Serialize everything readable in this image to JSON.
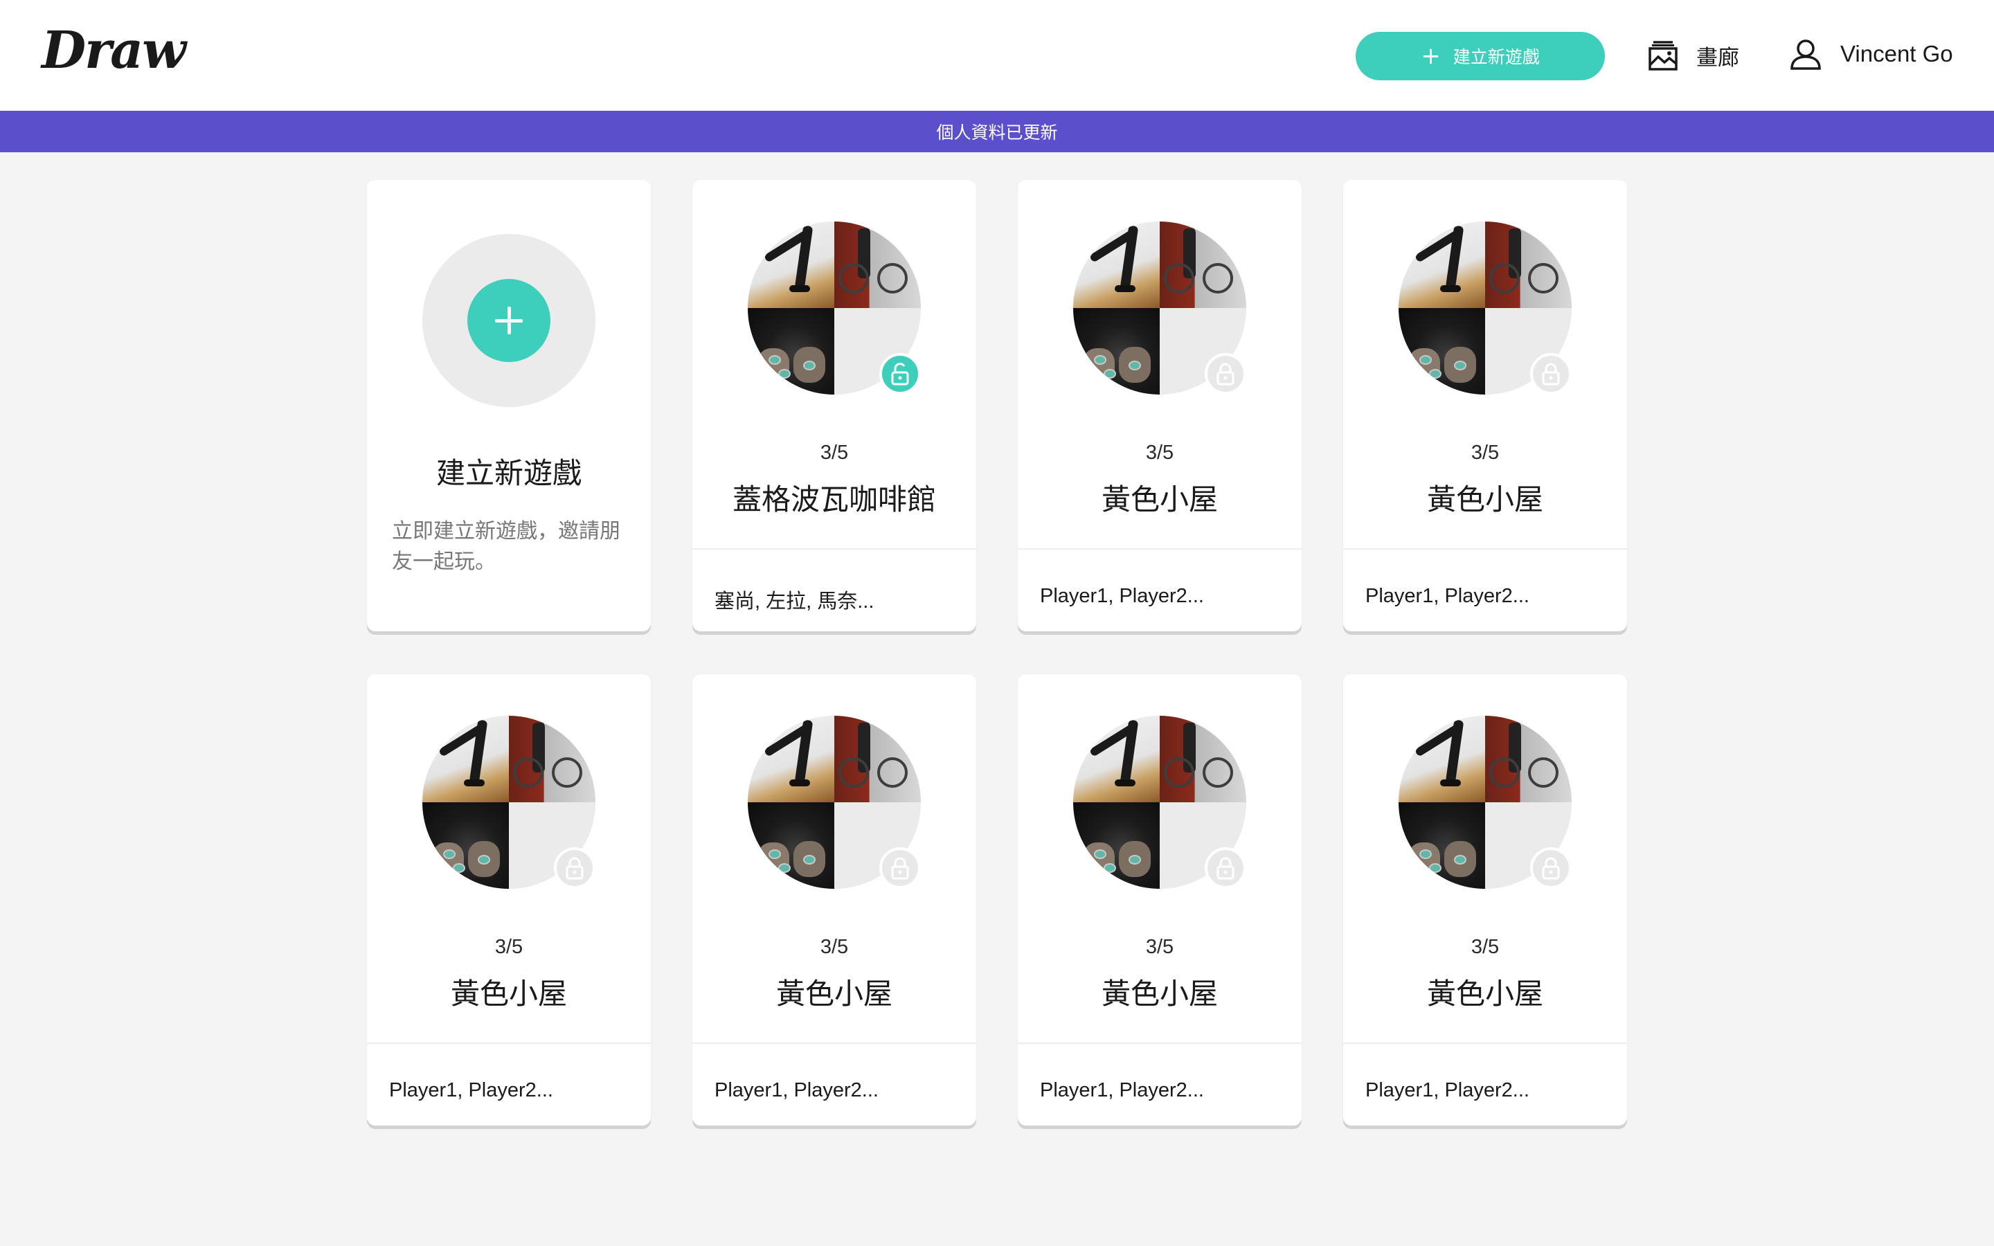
{
  "header": {
    "logo": "Draw",
    "new_game_button": "建立新遊戲",
    "gallery_label": "畫廊",
    "user_name": "Vincent Go"
  },
  "banner": {
    "message": "個人資料已更新"
  },
  "create_card": {
    "title": "建立新遊戲",
    "description": "立即建立新遊戲，邀請朋友一起玩。"
  },
  "rooms": [
    {
      "count": "3/5",
      "title": "蓋格波瓦咖啡館",
      "players": "塞尚, 左拉, 馬奈...",
      "locked": false
    },
    {
      "count": "3/5",
      "title": "黃色小屋",
      "players": "Player1, Player2...",
      "locked": true
    },
    {
      "count": "3/5",
      "title": "黃色小屋",
      "players": "Player1, Player2...",
      "locked": true
    },
    {
      "count": "3/5",
      "title": "黃色小屋",
      "players": "Player1, Player2...",
      "locked": true
    },
    {
      "count": "3/5",
      "title": "黃色小屋",
      "players": "Player1, Player2...",
      "locked": true
    },
    {
      "count": "3/5",
      "title": "黃色小屋",
      "players": "Player1, Player2...",
      "locked": true
    },
    {
      "count": "3/5",
      "title": "黃色小屋",
      "players": "Player1, Player2...",
      "locked": true
    }
  ],
  "colors": {
    "accent": "#3dcfbb",
    "banner": "#5b4fcb",
    "background": "#f4f4f4"
  },
  "icons": {
    "gallery": "gallery-icon",
    "user": "user-icon",
    "lock": "lock-icon",
    "unlock": "unlock-icon",
    "plus": "plus-icon"
  }
}
